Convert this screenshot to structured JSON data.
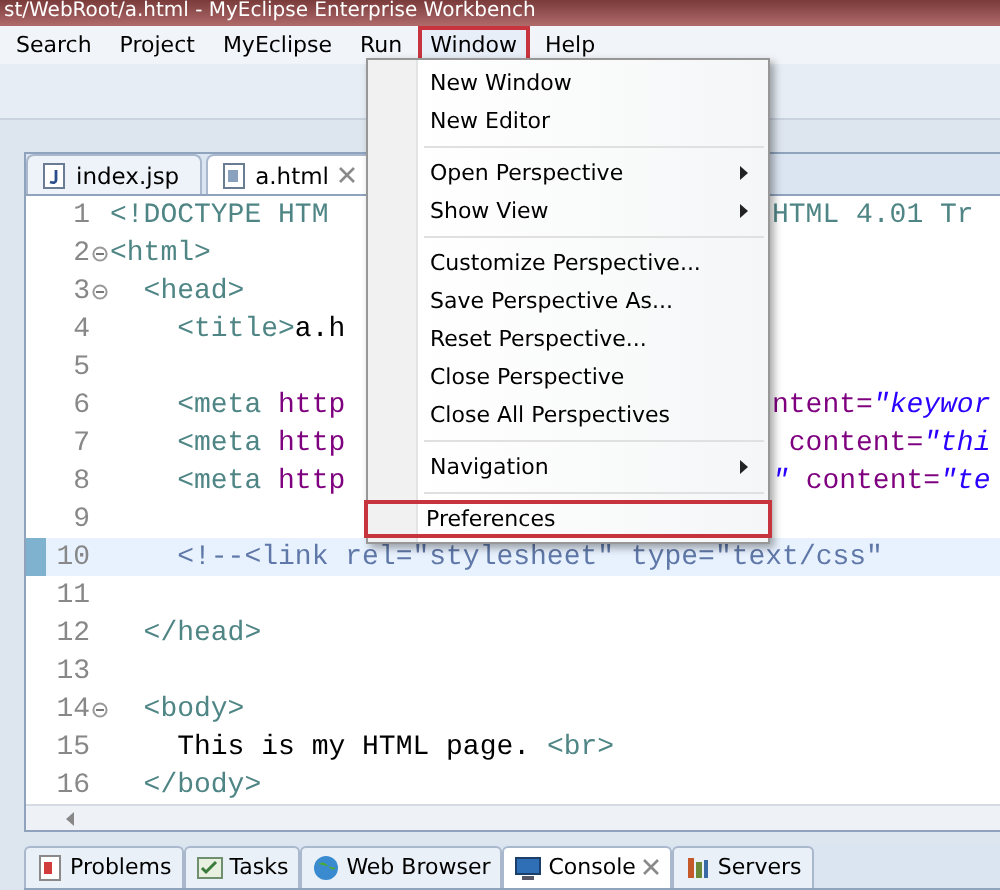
{
  "window": {
    "title": "st/WebRoot/a.html - MyEclipse Enterprise Workbench"
  },
  "menu_bar": [
    {
      "label": "Search",
      "selected": false
    },
    {
      "label": "Project",
      "selected": false
    },
    {
      "label": "MyEclipse",
      "selected": false
    },
    {
      "label": "Run",
      "selected": false
    },
    {
      "label": "Window",
      "selected": true
    },
    {
      "label": "Help",
      "selected": false
    }
  ],
  "editor_tabs": [
    {
      "label": "index.jsp",
      "kind": "jsp",
      "selected": false,
      "closable": false
    },
    {
      "label": "a.html",
      "kind": "html",
      "selected": true,
      "closable": true
    }
  ],
  "code_lines": [
    {
      "number": "1",
      "fold": false,
      "current": false,
      "left": [
        {
          "text": "<!DOCTYPE HTM",
          "kind": "tag"
        }
      ],
      "right": [
        {
          "text": "HTML 4.01 Tr",
          "kind": "tag"
        }
      ]
    },
    {
      "number": "2",
      "fold": true,
      "current": false,
      "left": [
        {
          "text": "<html>",
          "kind": "tag"
        }
      ]
    },
    {
      "number": "3",
      "fold": true,
      "current": false,
      "left": [
        {
          "text": "  <head>",
          "kind": "tag"
        }
      ]
    },
    {
      "number": "4",
      "fold": false,
      "current": false,
      "left": [
        {
          "text": "    <title>",
          "kind": "tag"
        },
        {
          "text": "a.h",
          "kind": "text"
        }
      ]
    },
    {
      "number": "5",
      "fold": false,
      "current": false
    },
    {
      "number": "6",
      "fold": false,
      "current": false,
      "left": [
        {
          "text": "    <meta ",
          "kind": "tag"
        },
        {
          "text": "http",
          "kind": "attr"
        }
      ],
      "right": [
        {
          "text": "ntent=",
          "kind": "attr"
        },
        {
          "text": "\"keywor",
          "kind": "value"
        }
      ]
    },
    {
      "number": "7",
      "fold": false,
      "current": false,
      "left": [
        {
          "text": "    <meta ",
          "kind": "tag"
        },
        {
          "text": "http",
          "kind": "attr"
        }
      ],
      "right": [
        {
          "text": " content=",
          "kind": "attr"
        },
        {
          "text": "\"thi",
          "kind": "value"
        }
      ]
    },
    {
      "number": "8",
      "fold": false,
      "current": false,
      "left": [
        {
          "text": "    <meta ",
          "kind": "tag"
        },
        {
          "text": "http",
          "kind": "attr"
        }
      ],
      "right": [
        {
          "text": "\" ",
          "kind": "value"
        },
        {
          "text": "content=",
          "kind": "attr"
        },
        {
          "text": "\"te",
          "kind": "value"
        }
      ]
    },
    {
      "number": "9",
      "fold": false,
      "current": false
    },
    {
      "number": "10",
      "fold": false,
      "current": true,
      "left": [
        {
          "text": "    <!--<link rel=\"stylesheet\" type=\"text/css\"",
          "kind": "comment"
        }
      ]
    },
    {
      "number": "11",
      "fold": false,
      "current": false
    },
    {
      "number": "12",
      "fold": false,
      "current": false,
      "left": [
        {
          "text": "  </head>",
          "kind": "tag"
        }
      ]
    },
    {
      "number": "13",
      "fold": false,
      "current": false
    },
    {
      "number": "14",
      "fold": true,
      "current": false,
      "left": [
        {
          "text": "  <body>",
          "kind": "tag"
        }
      ]
    },
    {
      "number": "15",
      "fold": false,
      "current": false,
      "left": [
        {
          "text": "    This is my HTML page. ",
          "kind": "text"
        },
        {
          "text": "<br>",
          "kind": "tag"
        }
      ]
    },
    {
      "number": "16",
      "fold": false,
      "current": false,
      "left": [
        {
          "text": "  </body>",
          "kind": "tag"
        }
      ]
    }
  ],
  "window_menu": [
    [
      {
        "label": "New Window",
        "submenu": false,
        "highlighted": false
      },
      {
        "label": "New Editor",
        "submenu": false,
        "highlighted": false
      }
    ],
    [
      {
        "label": "Open Perspective",
        "submenu": true,
        "highlighted": false
      },
      {
        "label": "Show View",
        "submenu": true,
        "highlighted": false
      }
    ],
    [
      {
        "label": "Customize Perspective...",
        "submenu": false,
        "highlighted": false
      },
      {
        "label": "Save Perspective As...",
        "submenu": false,
        "highlighted": false
      },
      {
        "label": "Reset Perspective...",
        "submenu": false,
        "highlighted": false
      },
      {
        "label": "Close Perspective",
        "submenu": false,
        "highlighted": false
      },
      {
        "label": "Close All Perspectives",
        "submenu": false,
        "highlighted": false
      }
    ],
    [
      {
        "label": "Navigation",
        "submenu": true,
        "highlighted": false
      }
    ],
    [
      {
        "label": "Preferences",
        "submenu": false,
        "highlighted": true
      }
    ]
  ],
  "bottom_tabs": [
    {
      "label": "Problems",
      "kind": "problems",
      "selected": false,
      "closable": false
    },
    {
      "label": "Tasks",
      "kind": "tasks",
      "selected": false,
      "closable": false
    },
    {
      "label": "Web Browser",
      "kind": "browser",
      "selected": false,
      "closable": false
    },
    {
      "label": "Console",
      "kind": "console",
      "selected": true,
      "closable": true
    },
    {
      "label": "Servers",
      "kind": "servers",
      "selected": false,
      "closable": false
    }
  ]
}
